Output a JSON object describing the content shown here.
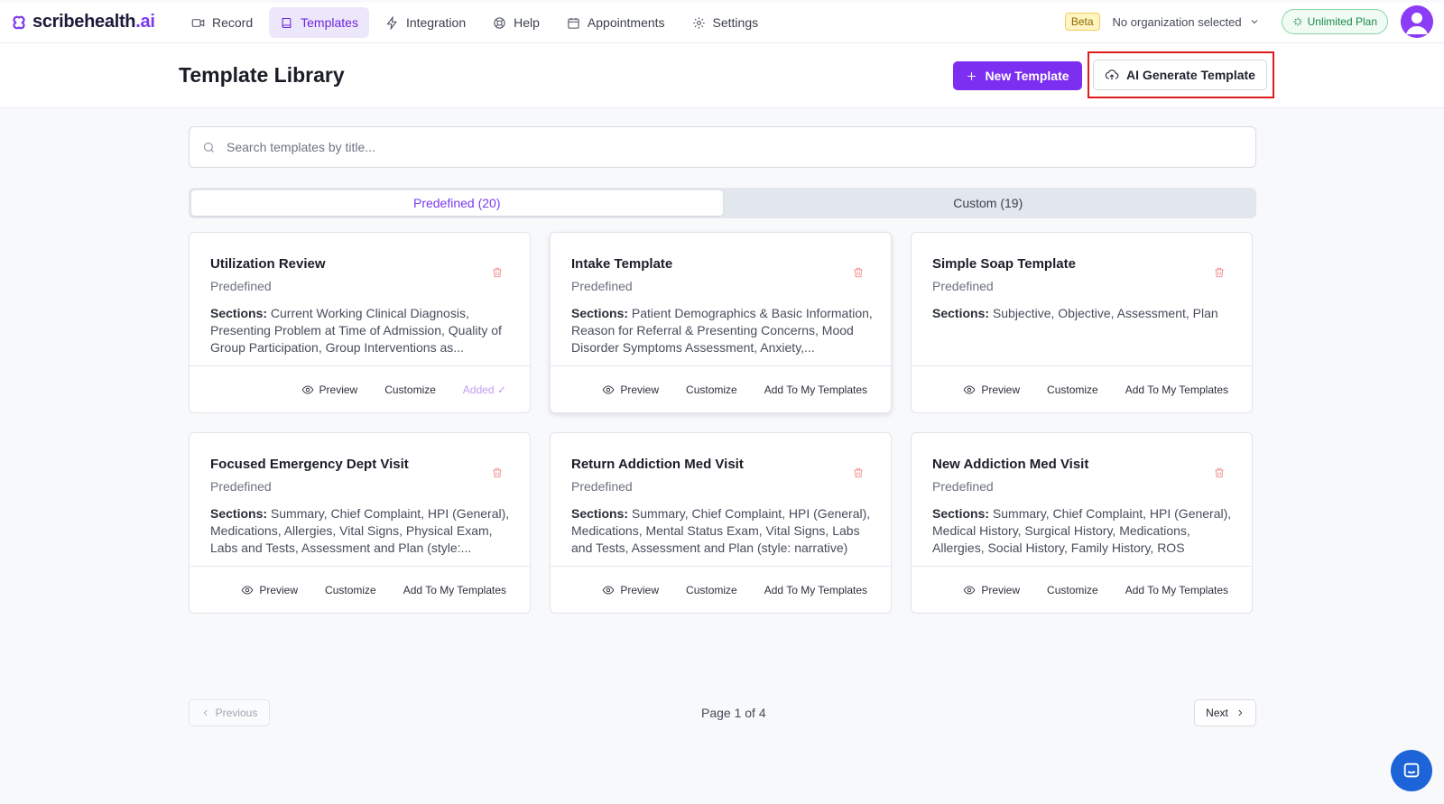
{
  "brand": {
    "name": "scribehealth",
    "suffix": ".ai"
  },
  "nav": [
    {
      "label": "Record",
      "icon": "video-icon",
      "active": false
    },
    {
      "label": "Templates",
      "icon": "book-icon",
      "active": true
    },
    {
      "label": "Integration",
      "icon": "lightning-icon",
      "active": false
    },
    {
      "label": "Help",
      "icon": "lifebuoy-icon",
      "active": false
    },
    {
      "label": "Appointments",
      "icon": "calendar-icon",
      "active": false
    },
    {
      "label": "Settings",
      "icon": "gear-icon",
      "active": false
    }
  ],
  "topright": {
    "beta": "Beta",
    "org": "No organization selected",
    "plan": "Unlimited Plan"
  },
  "header": {
    "title": "Template Library",
    "new_button": "New Template",
    "ai_button": "AI Generate Template"
  },
  "search": {
    "placeholder": "Search templates by title..."
  },
  "tabs": [
    {
      "label": "Predefined (20)",
      "active": true
    },
    {
      "label": "Custom (19)",
      "active": false
    }
  ],
  "card_labels": {
    "sections": "Sections:",
    "preview": "Preview",
    "customize": "Customize"
  },
  "cards": [
    {
      "title": "Utilization Review",
      "type": "Predefined",
      "sections": "Current Working Clinical Diagnosis, Presenting Problem at Time of Admission, Quality of Group Participation, Group Interventions as...",
      "action": "Added ✓"
    },
    {
      "title": "Intake Template",
      "type": "Predefined",
      "sections": "Patient Demographics & Basic Information, Reason for Referral & Presenting Concerns, Mood Disorder Symptoms Assessment, Anxiety,...",
      "action": "Add To My Templates"
    },
    {
      "title": "Simple Soap Template",
      "type": "Predefined",
      "sections": "Subjective, Objective, Assessment, Plan",
      "action": "Add To My Templates"
    },
    {
      "title": "Focused Emergency Dept Visit",
      "type": "Predefined",
      "sections": "Summary, Chief Complaint, HPI (General), Medications, Allergies, Vital Signs, Physical Exam, Labs and Tests, Assessment and Plan (style:...",
      "action": "Add To My Templates"
    },
    {
      "title": "Return Addiction Med Visit",
      "type": "Predefined",
      "sections": "Summary, Chief Complaint, HPI (General), Medications, Mental Status Exam, Vital Signs, Labs and Tests, Assessment and Plan (style: narrative)",
      "action": "Add To My Templates"
    },
    {
      "title": "New Addiction Med Visit",
      "type": "Predefined",
      "sections": "Summary, Chief Complaint, HPI (General), Medical History, Surgical History, Medications, Allergies, Social History, Family History, ROS (Revie...",
      "action": "Add To My Templates"
    }
  ],
  "pagination": {
    "previous": "Previous",
    "info": "Page 1 of 4",
    "next": "Next"
  },
  "colors": {
    "accent": "#7c2ff0",
    "highlight": "#e01b1b",
    "plan_green": "#1e8a4c",
    "chat_blue": "#1d64d8"
  }
}
